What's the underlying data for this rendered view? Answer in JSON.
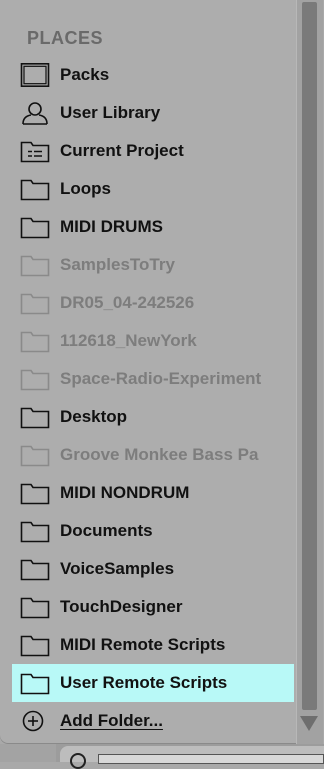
{
  "places": {
    "title": "PLACES",
    "items": [
      {
        "label": "Packs",
        "icon": "packs-icon",
        "dim": false,
        "selected": false
      },
      {
        "label": "User Library",
        "icon": "user-icon",
        "dim": false,
        "selected": false
      },
      {
        "label": "Current Project",
        "icon": "project-folder-icon",
        "dim": false,
        "selected": false
      },
      {
        "label": "Loops",
        "icon": "folder-icon",
        "dim": false,
        "selected": false
      },
      {
        "label": "MIDI DRUMS",
        "icon": "folder-icon",
        "dim": false,
        "selected": false
      },
      {
        "label": "SamplesToTry",
        "icon": "folder-icon",
        "dim": true,
        "selected": false
      },
      {
        "label": "DR05_04-242526",
        "icon": "folder-icon",
        "dim": true,
        "selected": false
      },
      {
        "label": "112618_NewYork",
        "icon": "folder-icon",
        "dim": true,
        "selected": false
      },
      {
        "label": "Space-Radio-Experiment",
        "icon": "folder-icon",
        "dim": true,
        "selected": false
      },
      {
        "label": "Desktop",
        "icon": "folder-icon",
        "dim": false,
        "selected": false
      },
      {
        "label": "Groove Monkee Bass Pa",
        "icon": "folder-icon",
        "dim": true,
        "selected": false
      },
      {
        "label": "MIDI NONDRUM",
        "icon": "folder-icon",
        "dim": false,
        "selected": false
      },
      {
        "label": "Documents",
        "icon": "folder-icon",
        "dim": false,
        "selected": false
      },
      {
        "label": "VoiceSamples",
        "icon": "folder-icon",
        "dim": false,
        "selected": false
      },
      {
        "label": "TouchDesigner",
        "icon": "folder-icon",
        "dim": false,
        "selected": false
      },
      {
        "label": "MIDI Remote Scripts",
        "icon": "folder-icon",
        "dim": false,
        "selected": false
      },
      {
        "label": "User Remote Scripts",
        "icon": "folder-icon",
        "dim": false,
        "selected": true
      }
    ],
    "add_folder_label": "Add Folder..."
  },
  "colors": {
    "panel_bg": "#adadad",
    "selected_bg": "#b8f9f7",
    "dim_text": "#7d7d7d",
    "text": "#111111",
    "title_text": "#6a6a6a"
  }
}
